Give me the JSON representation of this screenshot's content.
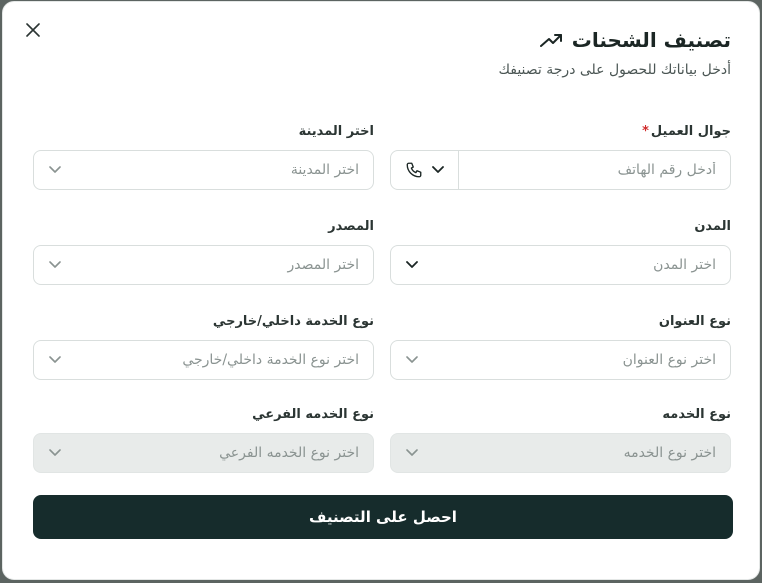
{
  "modal": {
    "title": "تصنيف الشحنات",
    "subtitle": "أدخل بياناتك للحصول على درجة تصنيفك",
    "submit_label": "احصل على التصنيف"
  },
  "fields": {
    "customer_phone": {
      "label": "جوال العميل",
      "required_mark": "*",
      "placeholder": "أدخل رقم الهاتف"
    },
    "city": {
      "label": "اختر المدينة",
      "placeholder": "اختر المدينة"
    },
    "cities": {
      "label": "المدن",
      "placeholder": "اختر المدن"
    },
    "source": {
      "label": "المصدر",
      "placeholder": "اختر المصدر"
    },
    "address_type": {
      "label": "نوع العنوان",
      "placeholder": "اختر نوع العنوان"
    },
    "service_scope": {
      "label": "نوع الخدمة داخلي/خارجي",
      "placeholder": "اختر نوع الخدمة داخلي/خارجي"
    },
    "service_type": {
      "label": "نوع الخدمه",
      "placeholder": "اختر نوع الخدمه"
    },
    "sub_service_type": {
      "label": "نوع الخدمه الفرعي",
      "placeholder": "اختر نوع الخدمه الفرعي"
    }
  },
  "icons": {
    "close": "close-icon",
    "title": "trending-up-icon",
    "phone": "phone-icon",
    "chevron": "chevron-down-icon"
  },
  "colors": {
    "primary": "#162c2c",
    "required": "#d02b2b",
    "disabled_bg": "#e8ebea"
  }
}
